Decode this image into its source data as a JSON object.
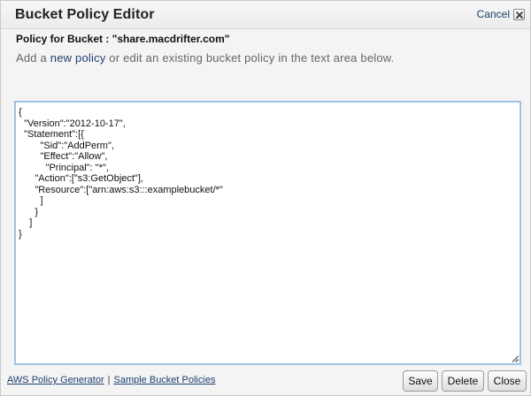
{
  "dialog": {
    "title": "Bucket Policy Editor",
    "cancel_label": "Cancel"
  },
  "subtitle": "Policy for Bucket : \"share.macdrifter.com\"",
  "instructions": {
    "prefix": "Add a ",
    "link": "new policy",
    "suffix": " or edit an existing bucket policy in the text area below."
  },
  "editor": {
    "content": "{\n  \"Version\":\"2012-10-17\",\n  \"Statement\":[{\n        \"Sid\":\"AddPerm\",\n        \"Effect\":\"Allow\",\n          \"Principal\": \"*\",\n      \"Action\":[\"s3:GetObject\"],\n      \"Resource\":[\"arn:aws:s3:::examplebucket/*\"\n        ]\n      }\n    ]\n}"
  },
  "footer": {
    "policy_generator": "AWS Policy Generator",
    "separator": "|",
    "sample_policies": "Sample Bucket Policies"
  },
  "buttons": {
    "save": "Save",
    "delete": "Delete",
    "close": "Close"
  }
}
